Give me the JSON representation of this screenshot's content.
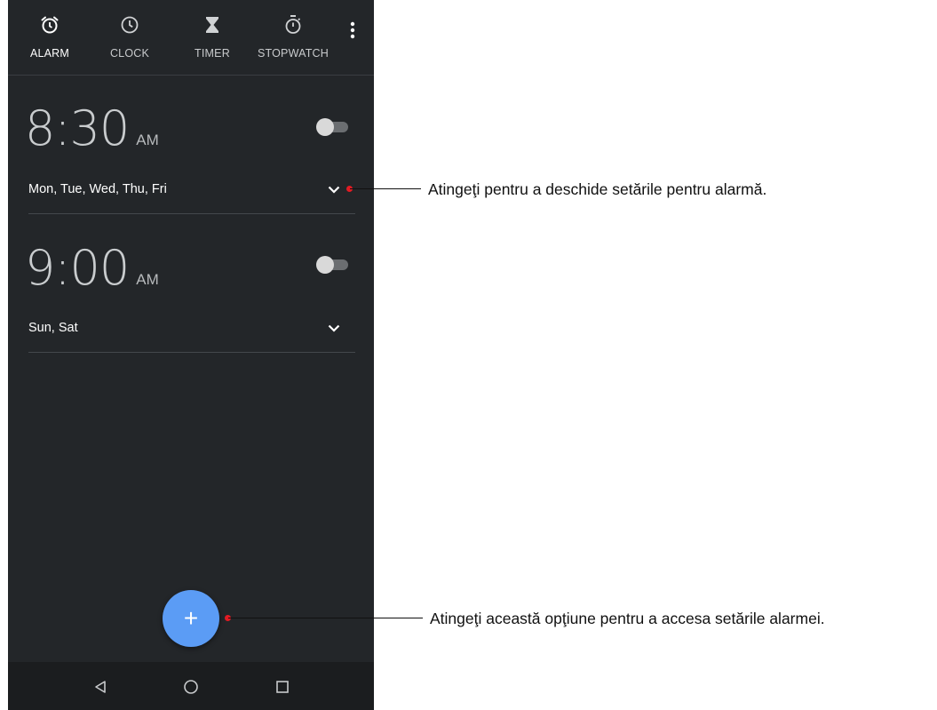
{
  "tabs": [
    {
      "id": "alarm",
      "label": "ALARM",
      "icon": "alarm-icon",
      "active": true
    },
    {
      "id": "clock",
      "label": "CLOCK",
      "icon": "clock-icon",
      "active": false
    },
    {
      "id": "timer",
      "label": "TIMER",
      "icon": "hourglass-icon",
      "active": false
    },
    {
      "id": "stopwatch",
      "label": "STOPWATCH",
      "icon": "stopwatch-icon",
      "active": false
    }
  ],
  "alarms": [
    {
      "time": "8:30",
      "ampm": "AM",
      "days": "Mon, Tue, Wed, Thu, Fri",
      "enabled": false
    },
    {
      "time": "9:00",
      "ampm": "AM",
      "days": "Sun, Sat",
      "enabled": false
    }
  ],
  "fab": {
    "symbol": "+",
    "icon": "add-icon"
  },
  "navbar": {
    "back_icon": "back-triangle-icon",
    "home_icon": "home-circle-icon",
    "recents_icon": "recents-square-icon"
  },
  "callouts": {
    "expand": "Atingeţi pentru a deschide setările pentru alarmă.",
    "add": "Atingeţi această opţiune pentru a accesa setările alarmei."
  },
  "colors": {
    "background": "#232629",
    "fab": "#5b9cf5",
    "callout_dot": "#e21b23"
  }
}
